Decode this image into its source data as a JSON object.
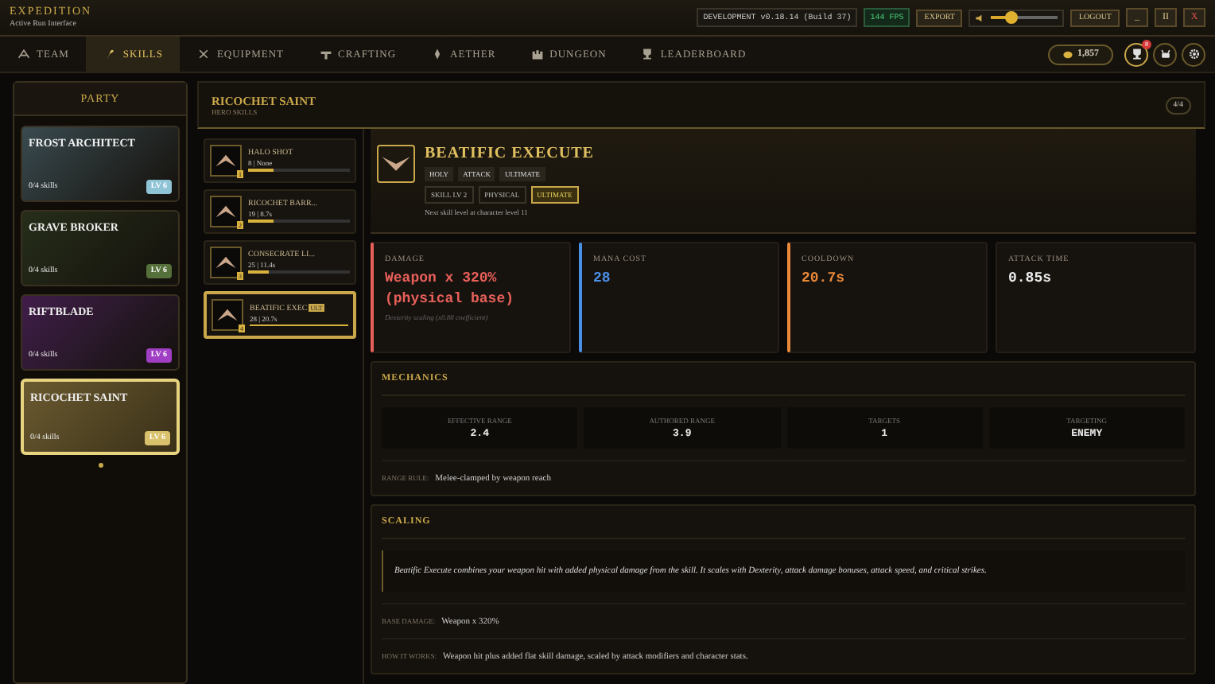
{
  "app": {
    "title": "EXPEDITION",
    "subtitle": "Active Run Interface"
  },
  "toolbar": {
    "build": "DEVELOPMENT v0.18.14 (Build 37)",
    "fps": "144 FPS",
    "export": "EXPORT",
    "volume": {
      "level": 0.3
    },
    "logout": "LOGOUT",
    "window_buttons": [
      {
        "kind": "minimize",
        "label": "_"
      },
      {
        "kind": "pause",
        "label": "II"
      },
      {
        "kind": "close",
        "label": "X"
      }
    ]
  },
  "tabs": [
    {
      "label": "TEAM",
      "selected": false
    },
    {
      "label": "SKILLS",
      "selected": true
    },
    {
      "label": "EQUIPMENT",
      "selected": false
    },
    {
      "label": "CRAFTING",
      "selected": false
    },
    {
      "label": "AETHER",
      "selected": false
    },
    {
      "label": "DUNGEON",
      "selected": false
    },
    {
      "label": "LEADERBOARD",
      "selected": false
    }
  ],
  "currency": "1,857",
  "notification_count": "8",
  "party": {
    "title": "PARTY",
    "heroes": [
      {
        "name": "FROST ARCHITECT",
        "skills": "0/4 skills",
        "level": "LV 6",
        "color": "#8fc3d6",
        "selected": false
      },
      {
        "name": "GRAVE BROKER",
        "skills": "0/4 skills",
        "level": "LV 6",
        "color": "#55703a",
        "selected": false
      },
      {
        "name": "RIFTBLADE",
        "skills": "0/4 skills",
        "level": "LV 6",
        "color": "#a13fc4",
        "selected": false
      },
      {
        "name": "RICOCHET SAINT",
        "skills": "0/4 skills",
        "level": "LV 6",
        "color": "#d9c06a",
        "selected": true
      }
    ]
  },
  "hero_panel": {
    "title": "RICOCHET SAINT",
    "subtitle": "HERO SKILLS",
    "count": "4/4"
  },
  "skills": [
    {
      "name": "HALO SHOT",
      "stats": "8 | None",
      "slot": "1",
      "level": 0.25,
      "selected": false
    },
    {
      "name": "RICOCHET BARR...",
      "stats": "19 | 8.7s",
      "slot": "2",
      "level": 0.25,
      "selected": false
    },
    {
      "name": "CONSECRATE LI...",
      "stats": "25 | 11.4s",
      "slot": "3",
      "level": 0.2,
      "selected": false
    },
    {
      "name": "BEATIFIC EXEC",
      "badge": "ULT",
      "stats": "28 | 20.7s",
      "slot": "4",
      "level": 1,
      "selected": true
    }
  ],
  "detail": {
    "title": "BEATIFIC EXECUTE",
    "tags": [
      "HOLY",
      "ATTACK",
      "ULTIMATE"
    ],
    "chips": [
      {
        "label": "SKILL LV 2",
        "highlight": false
      },
      {
        "label": "PHYSICAL",
        "highlight": false
      },
      {
        "label": "ULTIMATE",
        "highlight": true
      }
    ],
    "note": "Next skill level at character level 11",
    "stats": [
      {
        "label": "DAMAGE",
        "value": "Weapon x 320% (physical base)",
        "note": "Dexterity scaling (x0.88 coefficient)",
        "color": "#e8605a",
        "accent": true
      },
      {
        "label": "MANA COST",
        "value": "28",
        "color": "#4a8fe6",
        "accent": true
      },
      {
        "label": "COOLDOWN",
        "value": "20.7s",
        "color": "#e8893a",
        "accent": true
      },
      {
        "label": "ATTACK TIME",
        "value": "0.85s",
        "color": "#ececec",
        "accent": false
      }
    ],
    "mechanics": {
      "title": "MECHANICS",
      "cells": [
        {
          "label": "EFFECTIVE RANGE",
          "value": "2.4"
        },
        {
          "label": "AUTHORED RANGE",
          "value": "3.9"
        },
        {
          "label": "TARGETS",
          "value": "1"
        },
        {
          "label": "TARGETING",
          "value": "ENEMY"
        }
      ],
      "rule_label": "RANGE RULE:",
      "rule": "Melee-clamped by weapon reach"
    },
    "scaling": {
      "title": "SCALING",
      "quote": "Beatific Execute combines your weapon hit with added physical damage from the skill. It scales with Dexterity, attack damage bonuses, attack speed, and critical strikes.",
      "rows": [
        {
          "label": "BASE DAMAGE:",
          "value": "Weapon x 320%"
        },
        {
          "label": "HOW IT WORKS:",
          "value": "Weapon hit plus added flat skill damage, scaled by attack modifiers and character stats."
        }
      ]
    }
  }
}
